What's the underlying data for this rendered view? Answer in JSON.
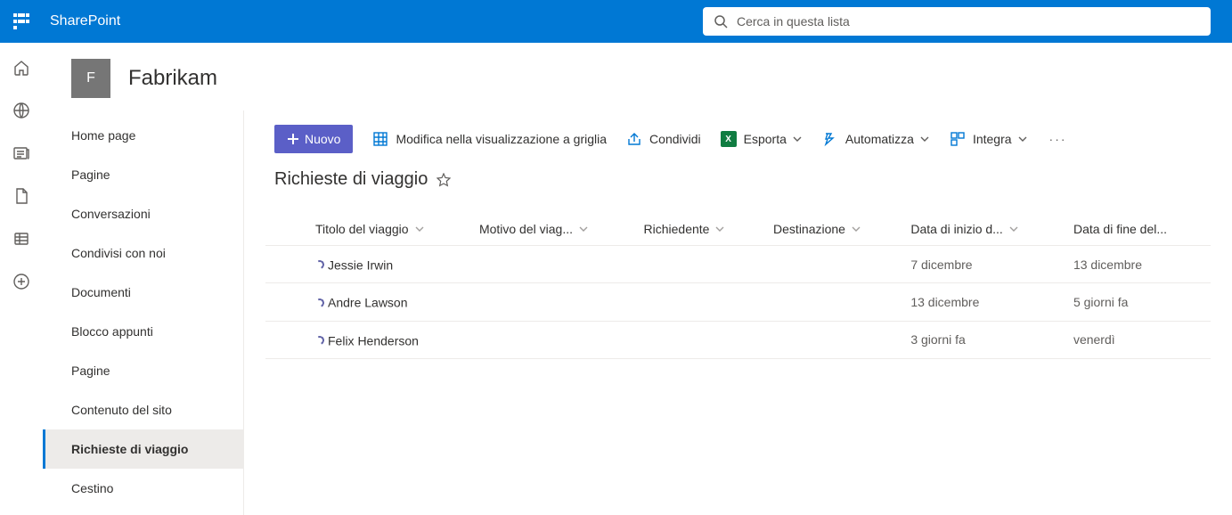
{
  "header": {
    "brand": "SharePoint",
    "search_placeholder": "Cerca in questa lista"
  },
  "site": {
    "logo_letter": "F",
    "title": "Fabrikam"
  },
  "nav": {
    "items": [
      {
        "label": "Home page",
        "selected": false
      },
      {
        "label": "Pagine",
        "selected": false
      },
      {
        "label": "Conversazioni",
        "selected": false
      },
      {
        "label": "Condivisi con noi",
        "selected": false
      },
      {
        "label": "Documenti",
        "selected": false
      },
      {
        "label": "Blocco appunti",
        "selected": false
      },
      {
        "label": "Pagine",
        "selected": false
      },
      {
        "label": "Contenuto del sito",
        "selected": false
      },
      {
        "label": "Richieste di viaggio",
        "selected": true
      },
      {
        "label": "Cestino",
        "selected": false
      }
    ]
  },
  "cmdbar": {
    "new": "Nuovo",
    "grid_edit": "Modifica nella visualizzazione a griglia",
    "share": "Condividi",
    "export": "Esporta",
    "automate": "Automatizza",
    "integrate": "Integra"
  },
  "list": {
    "title": "Richieste di viaggio",
    "columns": {
      "trip_title": "Titolo del viaggio",
      "reason": "Motivo del viag...",
      "requester": "Richiedente",
      "destination": "Destinazione",
      "start": "Data di inizio d...",
      "end": "Data di fine del..."
    },
    "rows": [
      {
        "title": "Jessie Irwin",
        "start": "7 dicembre",
        "end": "13 dicembre"
      },
      {
        "title": "Andre Lawson",
        "start": "13 dicembre",
        "end": "5 giorni fa"
      },
      {
        "title": "Felix Henderson",
        "start": "3 giorni fa",
        "end": "venerdì"
      }
    ]
  }
}
